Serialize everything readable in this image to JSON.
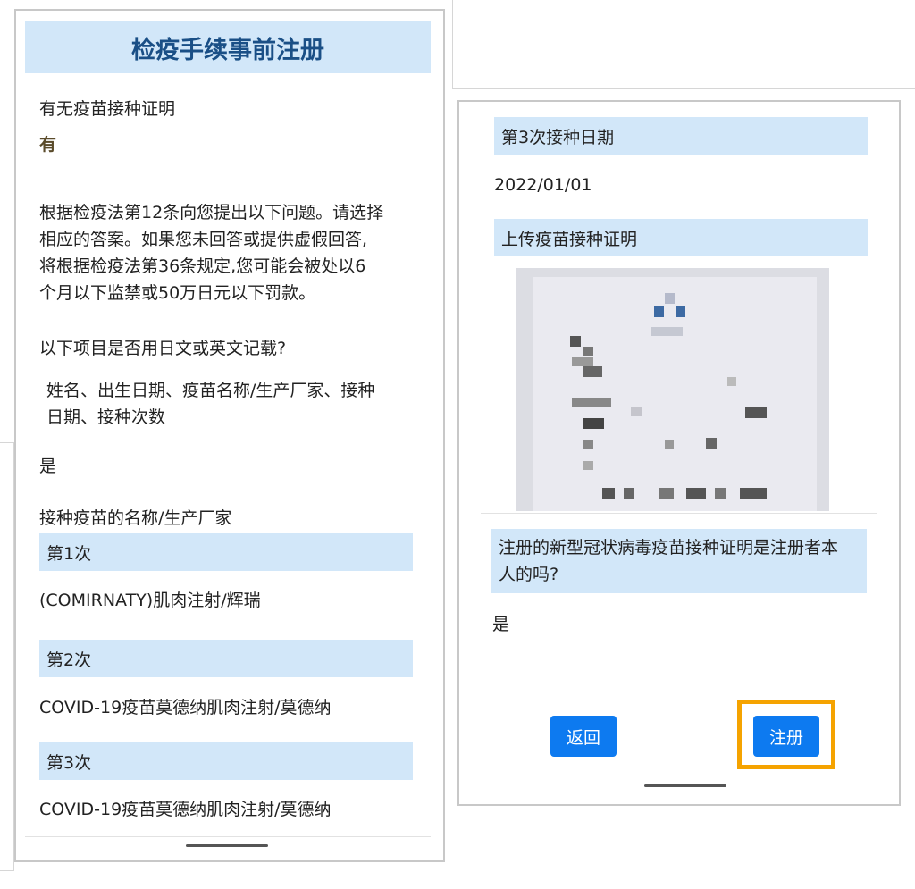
{
  "left": {
    "title": "检疫手续事前注册",
    "q_vaccine_cert": "有无疫苗接种证明",
    "a_vaccine_cert": "有",
    "notice_lines": [
      "根据检疫法第12条向您提出以下问题。请选择",
      "相应的答案。如果您未回答或提供虚假回答,",
      "将根据检疫法第36条规定,您可能会被处以6",
      "个月以下监禁或50万日元以下罚款。"
    ],
    "q_language": "以下项目是否用日文或英文记载?",
    "items_lines": [
      "姓名、出生日期、疫苗名称/生产厂家、接种",
      "日期、接种次数"
    ],
    "a_language": "是",
    "vaccine_name_label": "接种疫苗的名称/生产厂家",
    "doses": [
      {
        "label": "第1次",
        "value": "(COMIRNATY)肌肉注射/辉瑞"
      },
      {
        "label": "第2次",
        "value": "COVID-19疫苗莫德纳肌肉注射/莫德纳"
      },
      {
        "label": "第3次",
        "value": "COVID-19疫苗莫德纳肌肉注射/莫德纳"
      }
    ]
  },
  "right": {
    "third_date_label": "第3次接种日期",
    "third_date_value": "2022/01/01",
    "upload_label": "上传疫苗接种证明",
    "q_self_lines": [
      "注册的新型冠状病毒疫苗接种证明是注册者本",
      "人的吗?"
    ],
    "a_self": "是",
    "back_button": "返回",
    "register_button": "注册"
  },
  "colors": {
    "band_bg": "#d2e7f9",
    "title_text": "#1a4f86",
    "button_bg": "#0d7af0",
    "highlight": "#f5a300"
  },
  "icons": {
    "vaccine_certificate_image": "blurred-document-photo"
  }
}
